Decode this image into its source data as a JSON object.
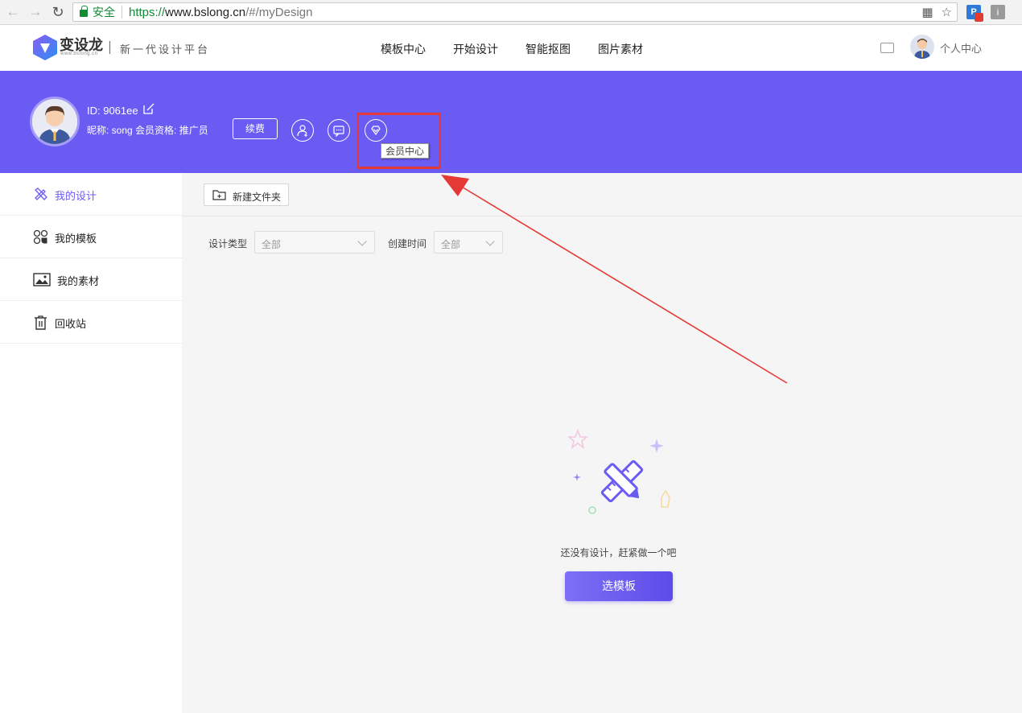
{
  "browser": {
    "back_icon": "arrow-left-icon",
    "forward_icon": "arrow-right-icon",
    "reload_icon": "reload-icon",
    "secure_label": "安全",
    "url_scheme": "https://",
    "url_host": "www.bslong.cn",
    "url_path": "/#/myDesign",
    "translate_icon": "translate-icon",
    "bookmark_icon": "star-icon",
    "ext1_label": "P",
    "ext2_label": "i"
  },
  "header": {
    "logo_name": "变设龙",
    "logo_sub": "www.bslong.cn",
    "slogan": "新一代设计平台",
    "menu": [
      "模板中心",
      "开始设计",
      "智能抠图",
      "图片素材"
    ],
    "personal_center": "个人中心"
  },
  "profile": {
    "id_text": "ID: 9061ee",
    "nick_text": "昵称:  song   会员资格:  推广员",
    "renew_label": "续费",
    "tooltip": "会员中心"
  },
  "sidebar": {
    "items": [
      {
        "label": "我的设计",
        "icon": "pencil-ruler-icon"
      },
      {
        "label": "我的模板",
        "icon": "template-grid-icon"
      },
      {
        "label": "我的素材",
        "icon": "image-icon"
      },
      {
        "label": "回收站",
        "icon": "trash-icon"
      }
    ]
  },
  "main": {
    "new_folder_label": "新建文件夹",
    "filter_type_label": "设计类型",
    "filter_type_value": "全部",
    "filter_time_label": "创建时间",
    "filter_time_value": "全部",
    "empty_text": "还没有设计，赶紧做一个吧",
    "pick_template_label": "选模板"
  },
  "colors": {
    "brand_purple": "#6a5bf3",
    "annotation_red": "#e53935"
  }
}
